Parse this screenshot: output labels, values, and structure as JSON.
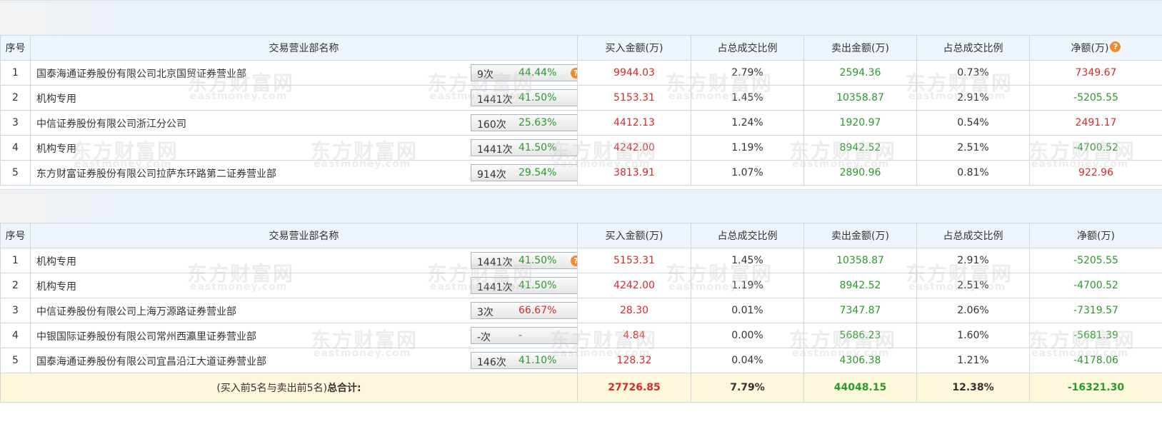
{
  "headers": [
    "序号",
    "交易营业部名称",
    "买入金额(万)",
    "占总成交比例",
    "卖出金额(万)",
    "占总成交比例",
    "净额(万)"
  ],
  "net_help_icon": "?",
  "buy_rows": [
    {
      "idx": "1",
      "name": "国泰海通证券股份有限公司北京国贸证券营业部",
      "count": "9次",
      "pct": "44.44%",
      "buy": "9944.03",
      "buy_ratio": "2.79%",
      "sell": "2594.36",
      "sell_ratio": "0.73%",
      "net": "7349.67"
    },
    {
      "idx": "2",
      "name": "机构专用",
      "count": "1441次",
      "pct": "41.50%",
      "buy": "5153.31",
      "buy_ratio": "1.45%",
      "sell": "10358.87",
      "sell_ratio": "2.91%",
      "net": "-5205.55"
    },
    {
      "idx": "3",
      "name": "中信证券股份有限公司浙江分公司",
      "count": "160次",
      "pct": "25.63%",
      "buy": "4412.13",
      "buy_ratio": "1.24%",
      "sell": "1920.97",
      "sell_ratio": "0.54%",
      "net": "2491.17"
    },
    {
      "idx": "4",
      "name": "机构专用",
      "count": "1441次",
      "pct": "41.50%",
      "buy": "4242.00",
      "buy_ratio": "1.19%",
      "sell": "8942.52",
      "sell_ratio": "2.51%",
      "net": "-4700.52"
    },
    {
      "idx": "5",
      "name": "东方财富证券股份有限公司拉萨东环路第二证券营业部",
      "count": "914次",
      "pct": "29.54%",
      "buy": "3813.91",
      "buy_ratio": "1.07%",
      "sell": "2890.96",
      "sell_ratio": "0.81%",
      "net": "922.96"
    }
  ],
  "sell_rows": [
    {
      "idx": "1",
      "name": "机构专用",
      "count": "1441次",
      "pct": "41.50%",
      "buy": "5153.31",
      "buy_ratio": "1.45%",
      "sell": "10358.87",
      "sell_ratio": "2.91%",
      "net": "-5205.55"
    },
    {
      "idx": "2",
      "name": "机构专用",
      "count": "1441次",
      "pct": "41.50%",
      "buy": "4242.00",
      "buy_ratio": "1.19%",
      "sell": "8942.52",
      "sell_ratio": "2.51%",
      "net": "-4700.52"
    },
    {
      "idx": "3",
      "name": "中信证券股份有限公司上海万源路证券营业部",
      "count": "3次",
      "pct": "66.67%",
      "buy": "28.30",
      "buy_ratio": "0.01%",
      "sell": "7347.87",
      "sell_ratio": "2.06%",
      "net": "-7319.57"
    },
    {
      "idx": "4",
      "name": "中银国际证券股份有限公司常州西瀛里证券营业部",
      "count": "-次",
      "pct": "-",
      "buy": "4.84",
      "buy_ratio": "0.00%",
      "sell": "5686.23",
      "sell_ratio": "1.60%",
      "net": "-5681.39"
    },
    {
      "idx": "5",
      "name": "国泰海通证券股份有限公司宜昌沿江大道证券营业部",
      "count": "146次",
      "pct": "41.10%",
      "buy": "128.32",
      "buy_ratio": "0.04%",
      "sell": "4306.38",
      "sell_ratio": "1.21%",
      "net": "-4178.06"
    }
  ],
  "total": {
    "label_prefix": "(买入前5名与卖出前5名)",
    "label_bold": "总合计:",
    "buy": "27726.85",
    "buy_ratio": "7.79%",
    "sell": "44048.15",
    "sell_ratio": "12.38%",
    "net": "-16321.30"
  },
  "watermark": {
    "cn": "东方财富网",
    "en": "eastmoney.com"
  },
  "colors": {
    "positive": "#d52b2b",
    "negative": "#2a9a2a",
    "header_bg": "#eef4fb",
    "band_bg": "#eaf2fa",
    "total_bg": "#fdf8dc",
    "help_icon": "#f08a30",
    "arrow": "#2b5a9e"
  }
}
